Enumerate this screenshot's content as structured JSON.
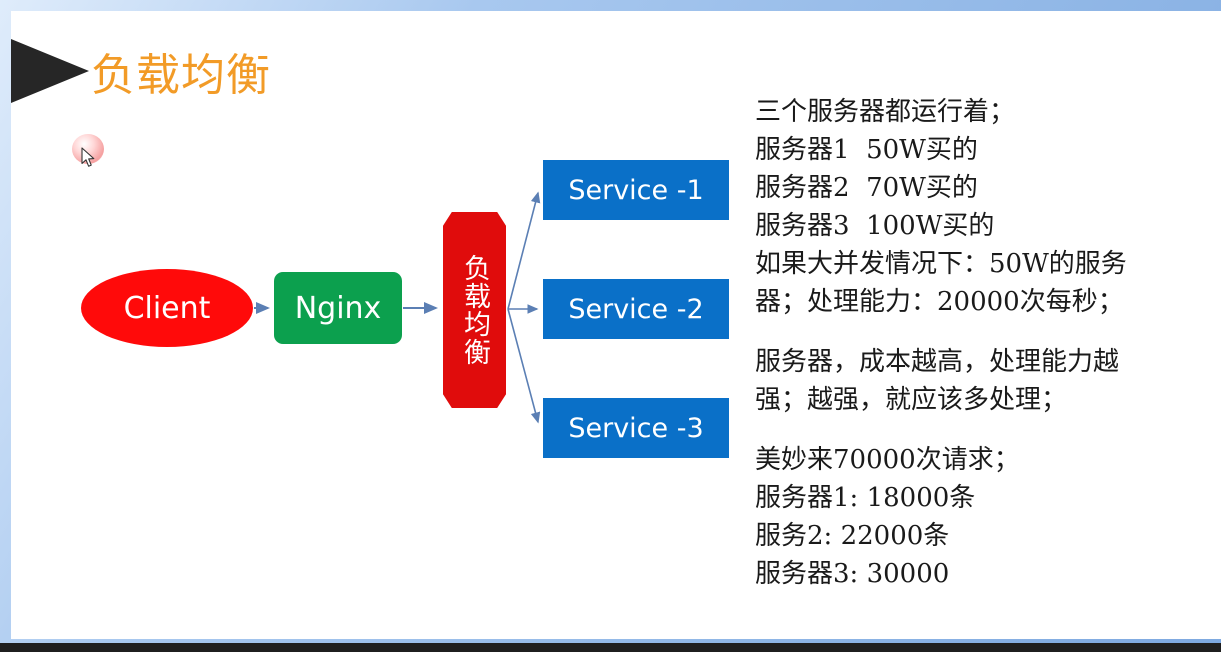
{
  "slide": {
    "title": "负载均衡",
    "title_color": "#F29B27"
  },
  "diagram": {
    "client": {
      "label": "Client",
      "color": "#FF0A0A"
    },
    "nginx": {
      "label": "Nginx",
      "color": "#0CA04E"
    },
    "load_balancer": {
      "label": "负载均衡",
      "color": "#E00C0C"
    },
    "services": [
      {
        "label": "Service -1",
        "color": "#0A70C8"
      },
      {
        "label": "Service -2",
        "color": "#0A70C8"
      },
      {
        "label": "Service -3",
        "color": "#0A70C8"
      }
    ],
    "connector_color": "#5B7FB4"
  },
  "notes": {
    "block1": [
      "三个服务器都运行着；",
      "服务器1  50W买的",
      "服务器2  70W买的",
      "服务器3  100W买的",
      "如果大并发情况下：50W的服务",
      "器；处理能力：20000次每秒；"
    ],
    "block2": [
      "服务器，成本越高，处理能力越",
      "强；越强，就应该多处理；"
    ],
    "block3": [
      "美妙来70000次请求；",
      "服务器1: 18000条",
      "服务2: 22000条",
      "服务器3: 30000"
    ]
  },
  "cursor": {
    "highlight_color": "#F5A0A0"
  }
}
